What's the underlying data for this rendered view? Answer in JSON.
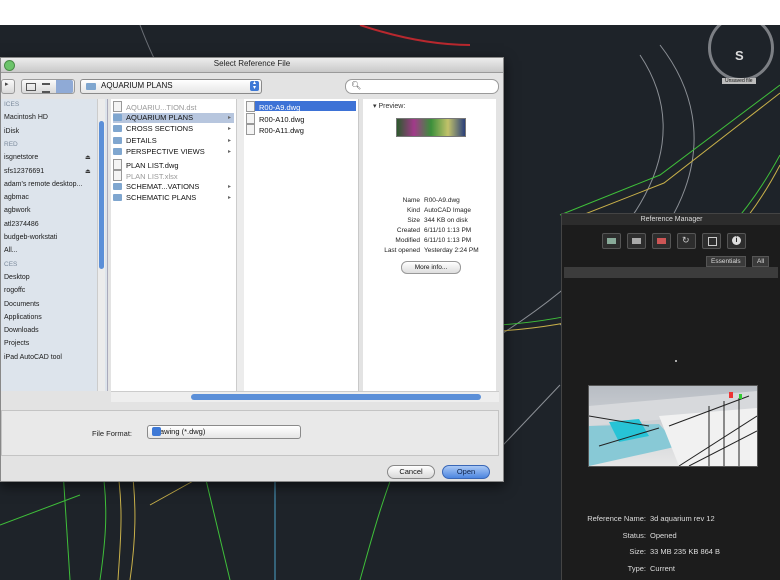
{
  "dialog": {
    "title": "Select Reference File",
    "location": "AQUARIUM PLANS",
    "search_placeholder": "",
    "sidebar": [
      {
        "label": "ICES",
        "section": true
      },
      {
        "label": "Macintosh HD"
      },
      {
        "label": "iDisk"
      },
      {
        "label": "RED",
        "section": true
      },
      {
        "label": "isgnetstore",
        "eject": true
      },
      {
        "label": "sfs12376691",
        "eject": true
      },
      {
        "label": "adam's remote desktop..."
      },
      {
        "label": "agbmac"
      },
      {
        "label": "agbwork"
      },
      {
        "label": "atl2374486"
      },
      {
        "label": "budgeb-workstati"
      },
      {
        "label": "All..."
      },
      {
        "label": "CES",
        "section": true
      },
      {
        "label": "Desktop"
      },
      {
        "label": "rogoffc"
      },
      {
        "label": "Documents"
      },
      {
        "label": "Applications"
      },
      {
        "label": "Downloads"
      },
      {
        "label": "Projects"
      },
      {
        "label": "iPad AutoCAD tool"
      }
    ],
    "column1": [
      {
        "label": "AQUARIU...TION.dst",
        "dim": true,
        "kind": "doc"
      },
      {
        "label": "AQUARIUM PLANS",
        "selected": true,
        "kind": "folder",
        "arrow": true
      },
      {
        "label": "CROSS SECTIONS",
        "kind": "folder",
        "arrow": true
      },
      {
        "label": "DETAILS",
        "kind": "folder",
        "arrow": true
      },
      {
        "label": "PERSPECTIVE VIEWS",
        "kind": "folder",
        "arrow": true
      },
      {
        "label": "PLAN LIST.dwg",
        "kind": "doc"
      },
      {
        "label": "PLAN LIST.xlsx",
        "dim": true,
        "kind": "doc"
      },
      {
        "label": "SCHEMAT...VATIONS",
        "kind": "folder",
        "arrow": true
      },
      {
        "label": "SCHEMATIC PLANS",
        "kind": "folder",
        "arrow": true
      }
    ],
    "column2": [
      {
        "label": "R00-A9.dwg",
        "highlight": true
      },
      {
        "label": "R00-A10.dwg"
      },
      {
        "label": "R00-A11.dwg"
      }
    ],
    "preview": {
      "header": "Preview:",
      "fields": [
        {
          "k": "Name",
          "v": "R00-A9.dwg"
        },
        {
          "k": "Kind",
          "v": "AutoCAD Image"
        },
        {
          "k": "Size",
          "v": "344 KB on disk"
        },
        {
          "k": "Created",
          "v": "6/11/10 1:13 PM"
        },
        {
          "k": "Modified",
          "v": "6/11/10 1:13 PM"
        },
        {
          "k": "Last opened",
          "v": "Yesterday 2:24 PM"
        }
      ],
      "more_info": "More info..."
    },
    "file_format_label": "File Format:",
    "file_format_value": "Drawing (*.dwg)",
    "cancel": "Cancel",
    "open": "Open"
  },
  "reference_manager": {
    "title": "Reference Manager",
    "tabs": [
      "Essentials",
      "All"
    ],
    "details": [
      {
        "k": "Reference Name:",
        "v": "3d aquarium rev 12"
      },
      {
        "k": "Status:",
        "v": "Opened"
      },
      {
        "k": "Size:",
        "v": "33 MB 235 KB 864 B"
      },
      {
        "k": "Type:",
        "v": "Current"
      }
    ]
  },
  "viewcube": {
    "label": "S",
    "badge": "Unsaved file"
  },
  "colors": {
    "canvas": "#1e2329",
    "accent": "#3d72d6",
    "lines_green": "#3fbf3a",
    "lines_yellow": "#c8b04a"
  }
}
